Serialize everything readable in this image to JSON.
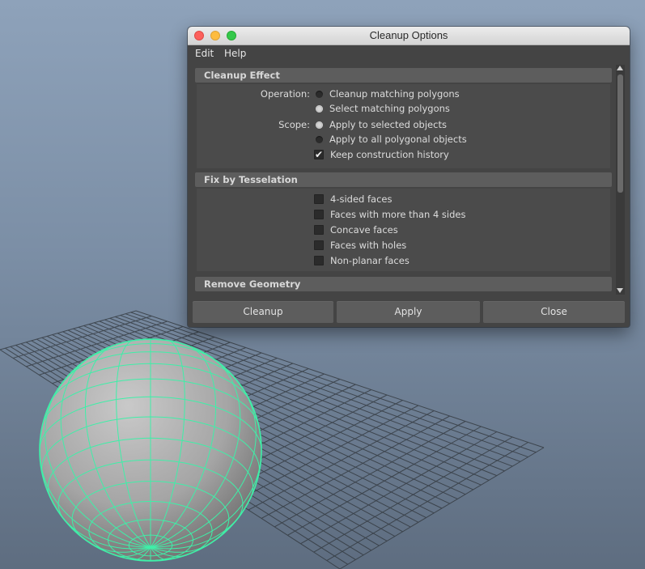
{
  "window": {
    "title": "Cleanup Options",
    "buttons": [
      "close",
      "minimize",
      "maximize"
    ]
  },
  "menubar": {
    "items": [
      "Edit",
      "Help"
    ]
  },
  "sections": {
    "cleanup_effect": {
      "header": "Cleanup Effect",
      "operation_label": "Operation:",
      "operation_options": [
        "Cleanup matching polygons",
        "Select matching polygons"
      ],
      "operation_selected": "Select matching polygons",
      "scope_label": "Scope:",
      "scope_options": [
        "Apply to selected objects",
        "Apply to all polygonal objects"
      ],
      "scope_selected": "Apply to selected objects",
      "keep_history_label": "Keep construction history",
      "keep_history_checked": true
    },
    "fix_by_tesselation": {
      "header": "Fix by Tesselation",
      "options": [
        "4-sided faces",
        "Faces with more than 4 sides",
        "Concave faces",
        "Faces with holes",
        "Non-planar faces"
      ],
      "checked": [
        false,
        false,
        false,
        false,
        false
      ]
    },
    "remove_geometry": {
      "header": "Remove Geometry"
    }
  },
  "footer": {
    "cleanup": "Cleanup",
    "apply": "Apply",
    "close": "Close"
  },
  "colors": {
    "wireframe": "#3fefa8",
    "panel": "#444444",
    "header": "#5d5d5d"
  },
  "icons": {
    "check": "checkmark-icon",
    "scroll_up": "arrow-up-icon",
    "scroll_down": "arrow-down-icon"
  }
}
